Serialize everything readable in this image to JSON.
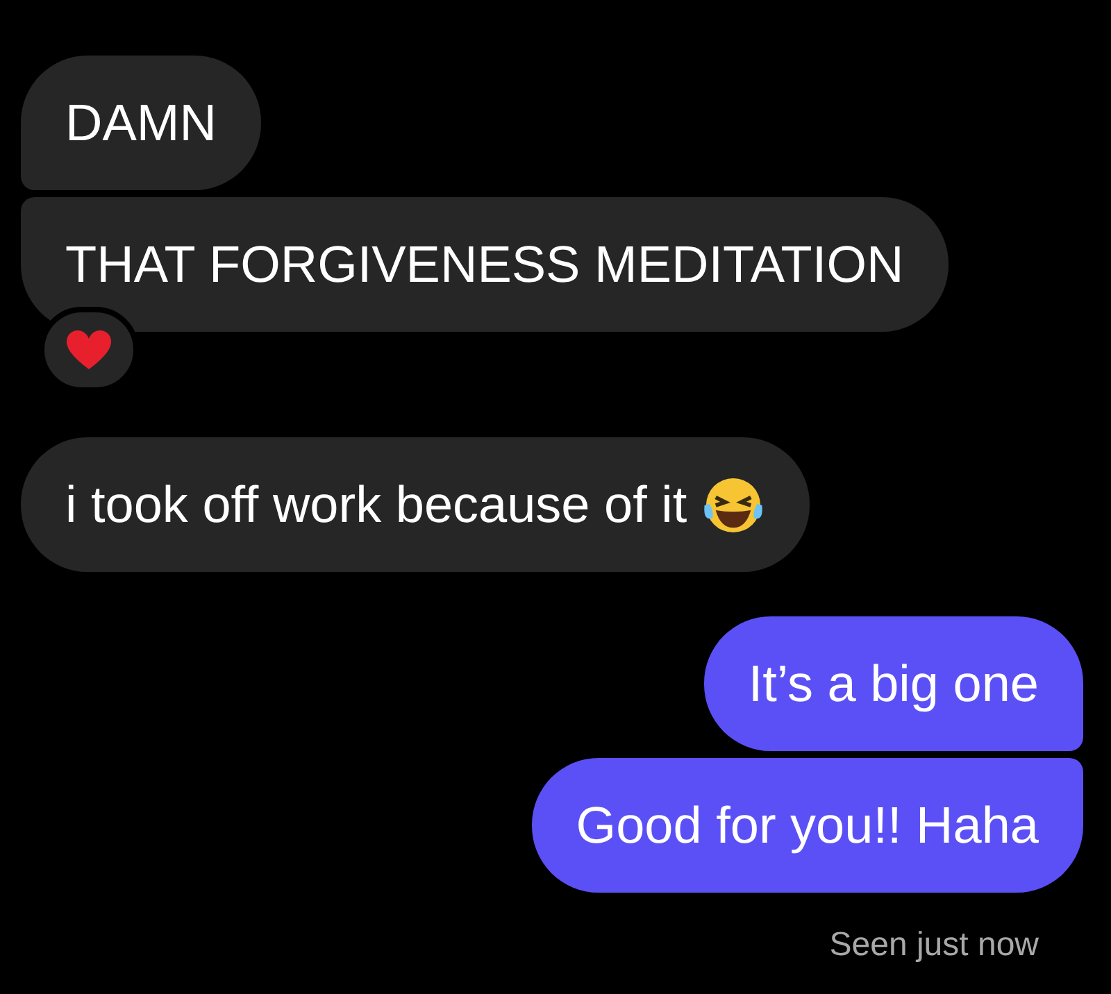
{
  "messages": [
    {
      "kind": "incoming",
      "text": "DAMN"
    },
    {
      "kind": "incoming",
      "text": "THAT FORGIVENESS MEDITATION",
      "reacted": true
    },
    {
      "kind": "incoming",
      "text": "i took off work because of it",
      "emoji": true
    },
    {
      "kind": "outgoing",
      "text": "It’s a big one"
    },
    {
      "kind": "outgoing",
      "text": "Good for you!! Haha"
    }
  ],
  "status": "Seen just now"
}
